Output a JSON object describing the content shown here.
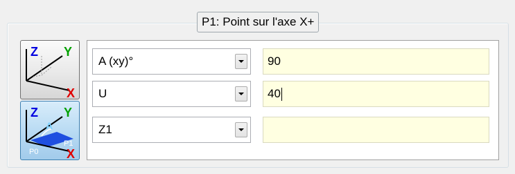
{
  "group": {
    "title": "P1: Point sur l'axe X+"
  },
  "icons": {
    "axes_button": "xyz-axes-icon",
    "plane_button": "xy-plane-angle-icon",
    "plane_labels": {
      "angle": "A",
      "p0": "P0",
      "p1": "P1"
    },
    "axis_labels": {
      "x": "X",
      "y": "Y",
      "z": "Z"
    }
  },
  "rows": [
    {
      "param": "A (xy)°",
      "value": "90"
    },
    {
      "param": "U",
      "value": "40"
    },
    {
      "param": "Z1",
      "value": ""
    }
  ],
  "colors": {
    "field_background": "#ffffe1",
    "axis_x": "#e00000",
    "axis_y": "#00a000",
    "axis_z": "#0000e0",
    "selected_button": "#b7daf3"
  }
}
